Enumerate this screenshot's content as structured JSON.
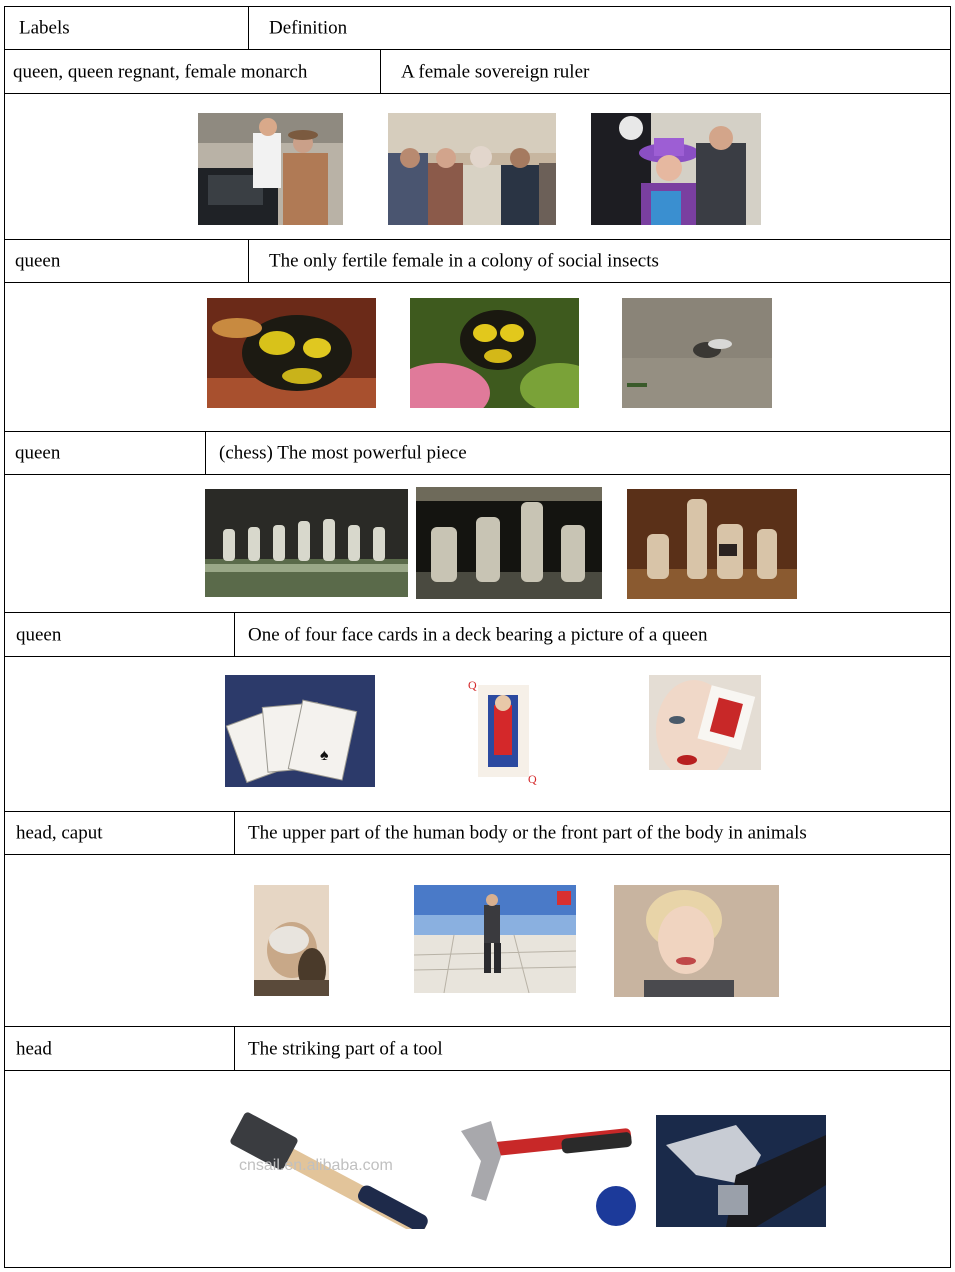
{
  "header": {
    "labels": "Labels",
    "definition": "Definition"
  },
  "senses": [
    {
      "labels": "queen, queen regnant, female monarch",
      "definition": "A female sovereign ruler",
      "images": [
        "monarch-photo-workshop",
        "monarch-photo-seated-elders",
        "monarch-photo-purple-hat"
      ]
    },
    {
      "labels": "queen",
      "definition": "The only fertile female in a colony of social insects",
      "images": [
        "wasp-closeup-photo",
        "wasp-on-flower-photo",
        "insect-on-ground-photo"
      ]
    },
    {
      "labels": "queen",
      "definition": "(chess) The most powerful piece",
      "images": [
        "glass-chess-row-photo",
        "glass-chess-pieces-photo",
        "ceramic-chess-pieces-photo"
      ]
    },
    {
      "labels": "queen",
      "definition": "One of four face cards in a deck bearing a picture of a queen",
      "images": [
        "card-fan-photo",
        "queen-of-hearts-card",
        "woman-holding-card-photo"
      ]
    },
    {
      "labels": "head, caput",
      "definition": "The upper part of the human body or the front part of the body in animals",
      "images": [
        "elderly-man-profile-photo",
        "man-on-salt-flat-photo",
        "smiling-woman-portrait-photo"
      ]
    },
    {
      "labels": "head",
      "definition": "The striking part of a tool",
      "images": [
        "sledge-hammer-photo",
        "claw-hammer-photo",
        "hammer-closeup-photo"
      ],
      "watermark": "cnsail.en.alibaba.com"
    }
  ]
}
